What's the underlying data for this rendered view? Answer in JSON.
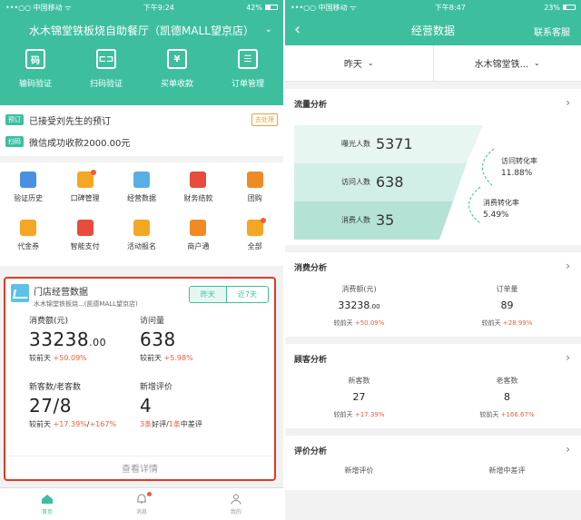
{
  "left": {
    "status": {
      "carrier": "•••○○ 中国移动 ᯤ",
      "time": "下午9:24",
      "battery": "42%"
    },
    "store_name": "水木锦堂铁板烧自助餐厅（凯德MALL望京店）",
    "quick_actions": [
      {
        "label": "输码验证",
        "glyph": "码"
      },
      {
        "label": "扫码验证",
        "glyph": "⊏⊐"
      },
      {
        "label": "买单收款",
        "glyph": "¥"
      },
      {
        "label": "订单管理",
        "glyph": "☰"
      }
    ],
    "notices": [
      {
        "tag": "预订",
        "text": "已接受刘先生的预订",
        "action": "去处理"
      },
      {
        "tag": "扫码",
        "text": "微信成功收款2000.00元",
        "action": ""
      }
    ],
    "grid": [
      {
        "label": "验证历史",
        "color": "#4a90e2",
        "dot": false
      },
      {
        "label": "口碑管理",
        "color": "#f5a623",
        "dot": true
      },
      {
        "label": "经营数据",
        "color": "#5aaee6",
        "dot": false
      },
      {
        "label": "财务结款",
        "color": "#e74c3c",
        "dot": false
      },
      {
        "label": "团购",
        "color": "#f08a24",
        "dot": false
      },
      {
        "label": "代金券",
        "color": "#f5a623",
        "dot": false
      },
      {
        "label": "智能支付",
        "color": "#e74c3c",
        "dot": false
      },
      {
        "label": "活动报名",
        "color": "#f5a623",
        "dot": false
      },
      {
        "label": "商户通",
        "color": "#f08a24",
        "dot": false
      },
      {
        "label": "全部",
        "color": "#f5a623",
        "dot": true
      }
    ],
    "card": {
      "title": "门店经营数据",
      "subtitle": "水木锦堂铁板烧...(凯德MALL望京店)",
      "segments": [
        "昨天",
        "近7天"
      ],
      "metrics": [
        {
          "label": "消费额(元)",
          "value": "33238",
          "decimal": ".00",
          "cmp_prefix": "较前天 ",
          "cmp": "+50.09%",
          "cmp_mid": "",
          "cmp2": ""
        },
        {
          "label": "访问量",
          "value": "638",
          "decimal": "",
          "cmp_prefix": "较前天 ",
          "cmp": "+5.98%",
          "cmp_mid": "",
          "cmp2": ""
        },
        {
          "label": "新客数/老客数",
          "value": "27/8",
          "decimal": "",
          "cmp_prefix": "较前天 ",
          "cmp": "+17.39%",
          "cmp_mid": "/",
          "cmp2": "+167%"
        },
        {
          "label": "新增评价",
          "value": "4",
          "decimal": "",
          "cmp_prefix": "",
          "cmp": "3条",
          "cmp_mid": "好评/",
          "cmp2": "1条",
          "cmp_suffix": "中差评"
        }
      ],
      "footer": "查看详情"
    },
    "tabs": [
      {
        "label": "首页",
        "active": true,
        "dot": false
      },
      {
        "label": "消息",
        "active": false,
        "dot": true
      },
      {
        "label": "我的",
        "active": false,
        "dot": false
      }
    ]
  },
  "right": {
    "status": {
      "carrier": "•••○○ 中国移动 ᯤ",
      "time": "下午8:47",
      "battery": "23%"
    },
    "title": "经营数据",
    "back": "‹",
    "service": "联系客服",
    "filters": [
      "昨天",
      "水木锦堂铁..."
    ],
    "traffic": {
      "title": "流量分析",
      "rows": [
        {
          "label": "曝光人数",
          "value": "5371"
        },
        {
          "label": "访问人数",
          "value": "638"
        },
        {
          "label": "消费人数",
          "value": "35"
        }
      ],
      "conversions": [
        {
          "label": "访问转化率",
          "value": "11.88%"
        },
        {
          "label": "消费转化率",
          "value": "5.49%"
        }
      ]
    },
    "consumption": {
      "title": "消费分析",
      "cols": [
        {
          "label": "消费额(元)",
          "value": "33238",
          "decimal": ".00",
          "cmp_prefix": "较前天 ",
          "cmp": "+50.09%"
        },
        {
          "label": "订单量",
          "value": "89",
          "decimal": "",
          "cmp_prefix": "较前天 ",
          "cmp": "+28.99%"
        }
      ]
    },
    "customers": {
      "title": "顾客分析",
      "cols": [
        {
          "label": "新客数",
          "value": "27",
          "decimal": "",
          "cmp_prefix": "较前天 ",
          "cmp": "+17.39%"
        },
        {
          "label": "老客数",
          "value": "8",
          "decimal": "",
          "cmp_prefix": "较前天 ",
          "cmp": "+166.67%"
        }
      ]
    },
    "reviews": {
      "title": "评价分析",
      "cols": [
        {
          "label": "新增评价"
        },
        {
          "label": "新增中差评"
        }
      ]
    }
  },
  "colors": {
    "brand": "#3dbf9e",
    "alert": "#f05b3b",
    "highlight": "#e03a24"
  }
}
